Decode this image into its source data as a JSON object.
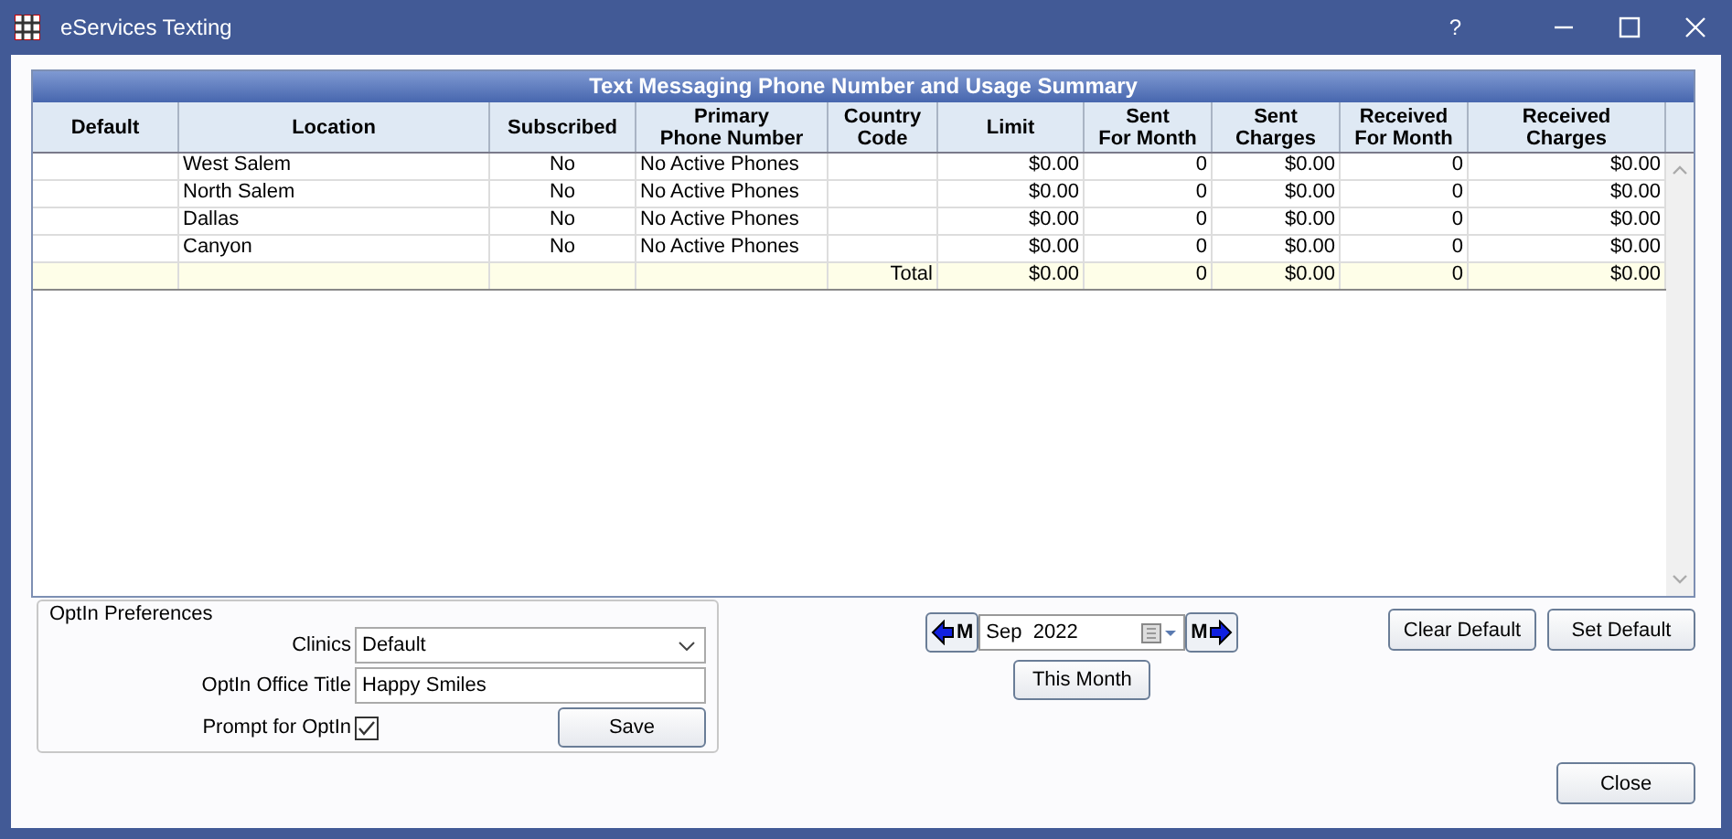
{
  "window": {
    "title": "eServices Texting",
    "help": "?"
  },
  "grid": {
    "title": "Text Messaging Phone Number and Usage Summary",
    "columns": [
      "Default",
      "Location",
      "Subscribed",
      "Primary\nPhone Number",
      "Country\nCode",
      "Limit",
      "Sent\nFor Month",
      "Sent\nCharges",
      "Received\nFor Month",
      "Received\nCharges"
    ],
    "rows": [
      {
        "kind": "data",
        "cells": [
          "",
          "West Salem",
          "No",
          "No Active Phones",
          "",
          "$0.00",
          "0",
          "$0.00",
          "0",
          "$0.00"
        ]
      },
      {
        "kind": "data",
        "cells": [
          "",
          "North Salem",
          "No",
          "No Active Phones",
          "",
          "$0.00",
          "0",
          "$0.00",
          "0",
          "$0.00"
        ]
      },
      {
        "kind": "data",
        "cells": [
          "",
          "Dallas",
          "No",
          "No Active Phones",
          "",
          "$0.00",
          "0",
          "$0.00",
          "0",
          "$0.00"
        ]
      },
      {
        "kind": "data",
        "cells": [
          "",
          "Canyon",
          "No",
          "No Active Phones",
          "",
          "$0.00",
          "0",
          "$0.00",
          "0",
          "$0.00"
        ]
      },
      {
        "kind": "total",
        "cells": [
          "",
          "",
          "",
          "",
          "Total",
          "$0.00",
          "0",
          "$0.00",
          "0",
          "$0.00"
        ]
      }
    ]
  },
  "optin": {
    "title": "OptIn Preferences",
    "clinics_label": "Clinics",
    "clinics_value": "Default",
    "office_title_label": "OptIn Office Title",
    "office_title_value": "Happy Smiles",
    "prompt_label": "Prompt for OptIn",
    "prompt_checked": true,
    "save": "Save"
  },
  "month": {
    "prev": "M",
    "value": "Sep  2022",
    "next": "M",
    "this_month": "This Month"
  },
  "buttons": {
    "clear_default": "Clear Default",
    "set_default": "Set Default",
    "close": "Close"
  }
}
